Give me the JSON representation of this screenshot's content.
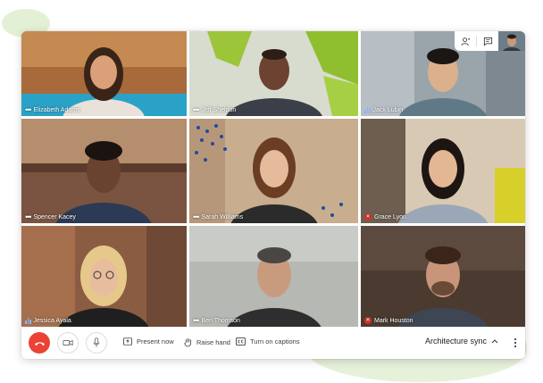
{
  "participants": [
    {
      "name": "Elizabeth Adams",
      "audio": "idle"
    },
    {
      "name": "Jeff Sheldon",
      "audio": "idle"
    },
    {
      "name": "Jack Lubin",
      "audio": "speaking"
    },
    {
      "name": "Spencer Kacey",
      "audio": "idle"
    },
    {
      "name": "Sarah Williams",
      "audio": "idle"
    },
    {
      "name": "Grace Lyon",
      "audio": "muted"
    },
    {
      "name": "Jessica Ayala",
      "audio": "speaking"
    },
    {
      "name": "Ben Thomson",
      "audio": "idle"
    },
    {
      "name": "Mark Houston",
      "audio": "muted"
    }
  ],
  "toolbar": {
    "present_label": "Present now",
    "raise_label": "Raise hand",
    "captions_label": "Turn on captions",
    "meeting_title": "Architecture sync"
  },
  "icons": {
    "end_call": "phone-hangup-icon",
    "camera": "video-camera-icon",
    "mic": "microphone-icon",
    "present": "present-screen-icon",
    "raise": "hand-icon",
    "captions": "closed-captions-icon",
    "people": "people-icon",
    "chat": "chat-icon",
    "more": "kebab-menu-icon"
  },
  "colors": {
    "end_call": "#ea4335",
    "muted": "#d93025",
    "speaking": "#8ab4f8",
    "accent_blob": "#e6f1d9"
  }
}
